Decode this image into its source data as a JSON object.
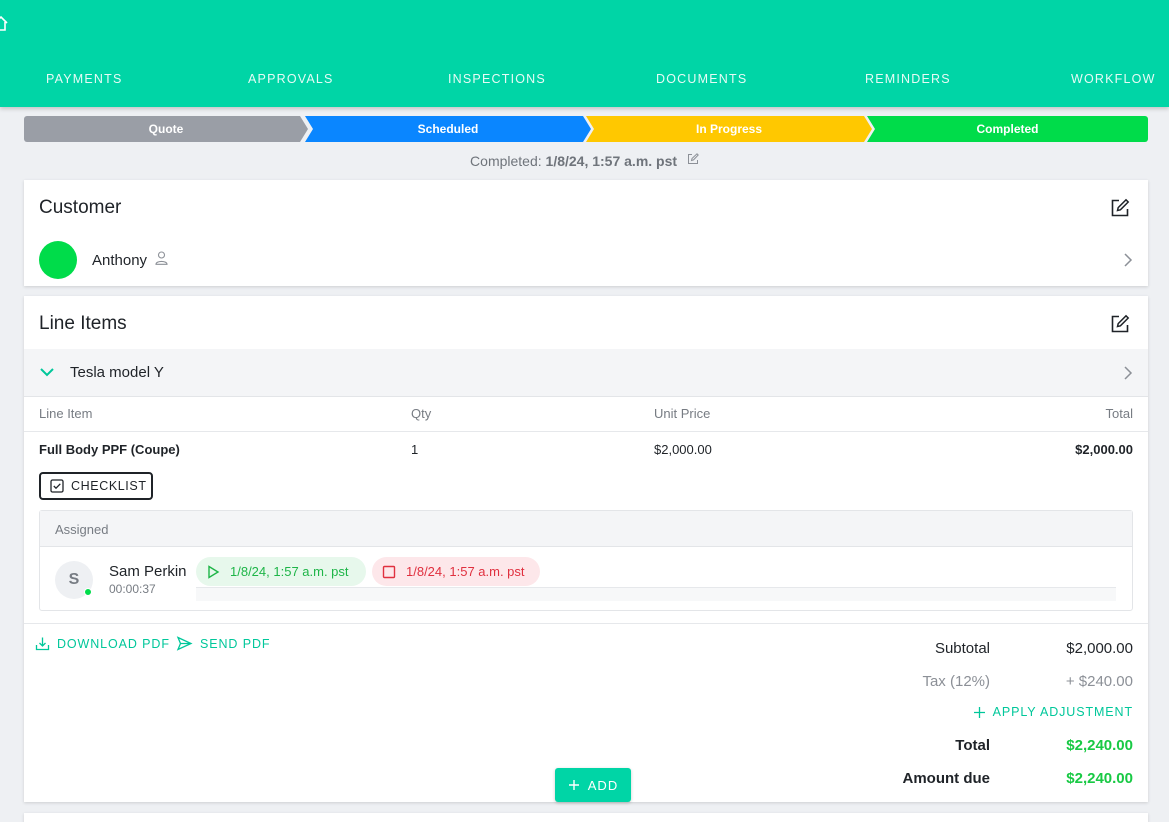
{
  "nav": {
    "items": [
      "PAYMENTS",
      "APPROVALS",
      "INSPECTIONS",
      "DOCUMENTS",
      "REMINDERS",
      "WORKFLOW"
    ]
  },
  "stepper": {
    "steps": [
      "Quote",
      "Scheduled",
      "In Progress",
      "Completed"
    ]
  },
  "completed": {
    "label": "Completed:",
    "value": "1/8/24, 1:57 a.m. pst"
  },
  "customer": {
    "title": "Customer",
    "name": "Anthony"
  },
  "line_items": {
    "title": "Line Items",
    "vehicle": "Tesla model Y",
    "columns": {
      "line_item": "Line Item",
      "qty": "Qty",
      "unit_price": "Unit Price",
      "total": "Total"
    },
    "rows": [
      {
        "name": "Full Body PPF (Coupe)",
        "qty": "1",
        "unit_price": "$2,000.00",
        "total": "$2,000.00"
      }
    ],
    "checklist_label": "CHECKLIST",
    "assigned": {
      "label": "Assigned",
      "worker_initial": "S",
      "worker_name": "Sam Perkin",
      "worker_duration": "00:00:37",
      "start_time": "1/8/24, 1:57 a.m. pst",
      "stop_time": "1/8/24, 1:57 a.m. pst"
    }
  },
  "actions": {
    "download_pdf": "DOWNLOAD PDF",
    "send_pdf": "SEND PDF",
    "apply_adjustment": "APPLY ADJUSTMENT",
    "add": "ADD"
  },
  "summary": {
    "subtotal_label": "Subtotal",
    "subtotal_value": "$2,000.00",
    "tax_label": "Tax (12%)",
    "tax_value": "+ $240.00",
    "total_label": "Total",
    "total_value": "$2,240.00",
    "amount_due_label": "Amount due",
    "amount_due_value": "$2,240.00"
  },
  "colors": {
    "brand": "#00d5a6",
    "quote": "#9a9ea6",
    "scheduled": "#0a86ff",
    "in_progress": "#ffc800",
    "completed": "#00dc4a"
  }
}
